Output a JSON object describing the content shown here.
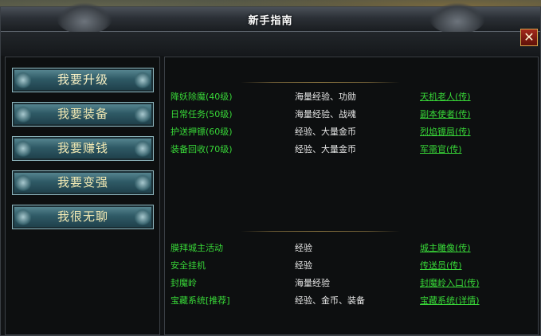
{
  "window": {
    "title": "新手指南",
    "close_label": "✕"
  },
  "menu": [
    {
      "label": "我要升级"
    },
    {
      "label": "我要装备"
    },
    {
      "label": "我要赚钱"
    },
    {
      "label": "我要变强"
    },
    {
      "label": "我很无聊"
    }
  ],
  "section1": [
    {
      "name": "降妖除魔(40级)",
      "reward": "海量经验、功勋",
      "npc": "天机老人(传)"
    },
    {
      "name": "日常任务(50级)",
      "reward": "海量经验、战魂",
      "npc": "副本使者(传)"
    },
    {
      "name": "护送押镖(60级)",
      "reward": "经验、大量金币",
      "npc": "烈焰镖局(传)"
    },
    {
      "name": "装备回收(70级)",
      "reward": "经验、大量金币",
      "npc": "军需官(传)"
    }
  ],
  "section2": [
    {
      "name": "膜拜城主活动",
      "reward": "经验",
      "npc": "城主雕像(传)"
    },
    {
      "name": "安全挂机",
      "reward": "经验",
      "npc": "传送员(传)"
    },
    {
      "name": "封魔岭",
      "reward": "海量经验",
      "npc": "封魔岭入口(传)"
    },
    {
      "name": "宝藏系统[推荐]",
      "reward": "经验、金币、装备",
      "npc": "宝藏系统(详情)"
    }
  ],
  "colors": {
    "accent_green": "#38d838",
    "button_text": "#f2e9b3",
    "close_red": "#a32a1c"
  }
}
